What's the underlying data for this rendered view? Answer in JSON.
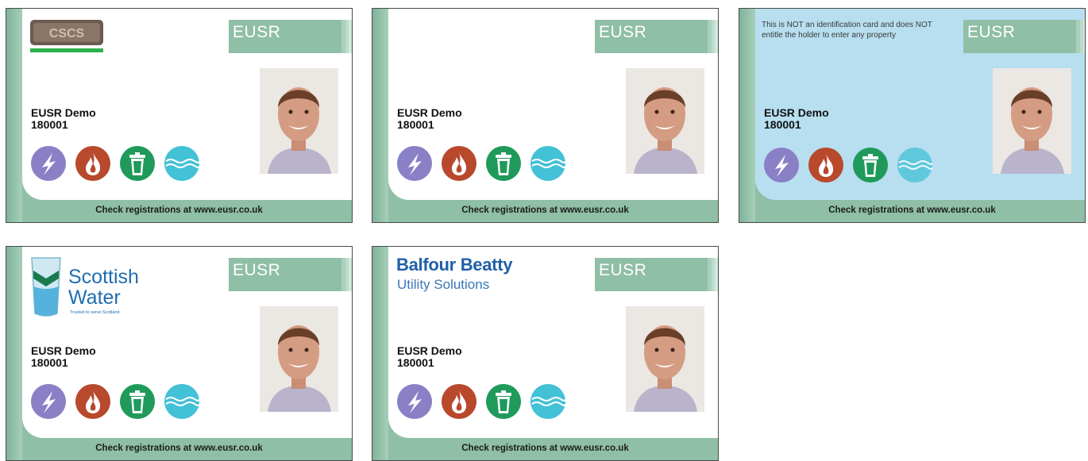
{
  "brand_text": "EUSR",
  "holder_name": "EUSR Demo",
  "holder_number": "180001",
  "footer_text": "Check registrations at www.eusr.co.uk",
  "notice_text": "This is NOT an identification card and does NOT entitle the holder to enter any property",
  "cscs_logo_text": "CSCS",
  "scottish_water": {
    "line1": "Scottish",
    "line2": "Water",
    "tagline": "Trusted to serve Scotland"
  },
  "balfour_beatty": {
    "title": "Balfour Beatty",
    "subtitle": "Utility Solutions"
  },
  "colors": {
    "frame": "#8fbfa6",
    "electric": "#8a80c6",
    "gas": "#b8492c",
    "waste": "#1f9a5a",
    "water": "#43c1d6",
    "blue_card_bg": "#b7dff0",
    "bb_blue": "#1f5fa8"
  },
  "icons": [
    "electricity-icon",
    "gas-flame-icon",
    "waste-bin-icon",
    "water-wave-icon"
  ]
}
